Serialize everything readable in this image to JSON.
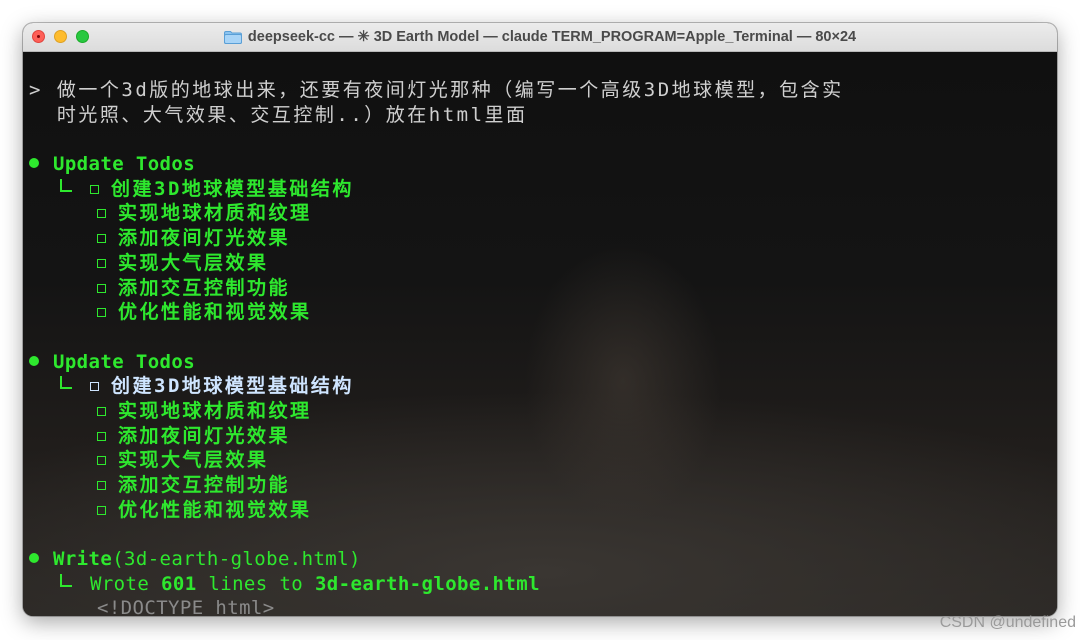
{
  "window": {
    "title": "deepseek-cc — ✳ 3D Earth Model — claude TERM_PROGRAM=Apple_Terminal — 80×24"
  },
  "terminal": {
    "prompt_marker": ">",
    "prompt_line1": "做一个3d版的地球出来，还要有夜间灯光那种（编写一个高级3D地球模型，包含实",
    "prompt_line2": "时光照、大气效果、交互控制..）放在html里面",
    "todos_block_1": {
      "header": "Update Todos",
      "items": [
        "创建3D地球模型基础结构",
        "实现地球材质和纹理",
        "添加夜间灯光效果",
        "实现大气层效果",
        "添加交互控制功能",
        "优化性能和视觉效果"
      ]
    },
    "todos_block_2": {
      "header": "Update Todos",
      "items": [
        "创建3D地球模型基础结构",
        "实现地球材质和纹理",
        "添加夜间灯光效果",
        "实现大气层效果",
        "添加交互控制功能",
        "优化性能和视觉效果"
      ]
    },
    "write": {
      "tool": "Write",
      "args": "(3d-earth-globe.html)",
      "result_prefix": "Wrote ",
      "line_count": "601",
      "result_mid": " lines to ",
      "file": "3d-earth-globe.html",
      "preview": "<!DOCTYPE html>"
    }
  },
  "watermark": "CSDN @undefined",
  "colors": {
    "accent_green": "#2ee82e",
    "active_item": "#cfe5ff",
    "terminal_bg": "#151515"
  }
}
